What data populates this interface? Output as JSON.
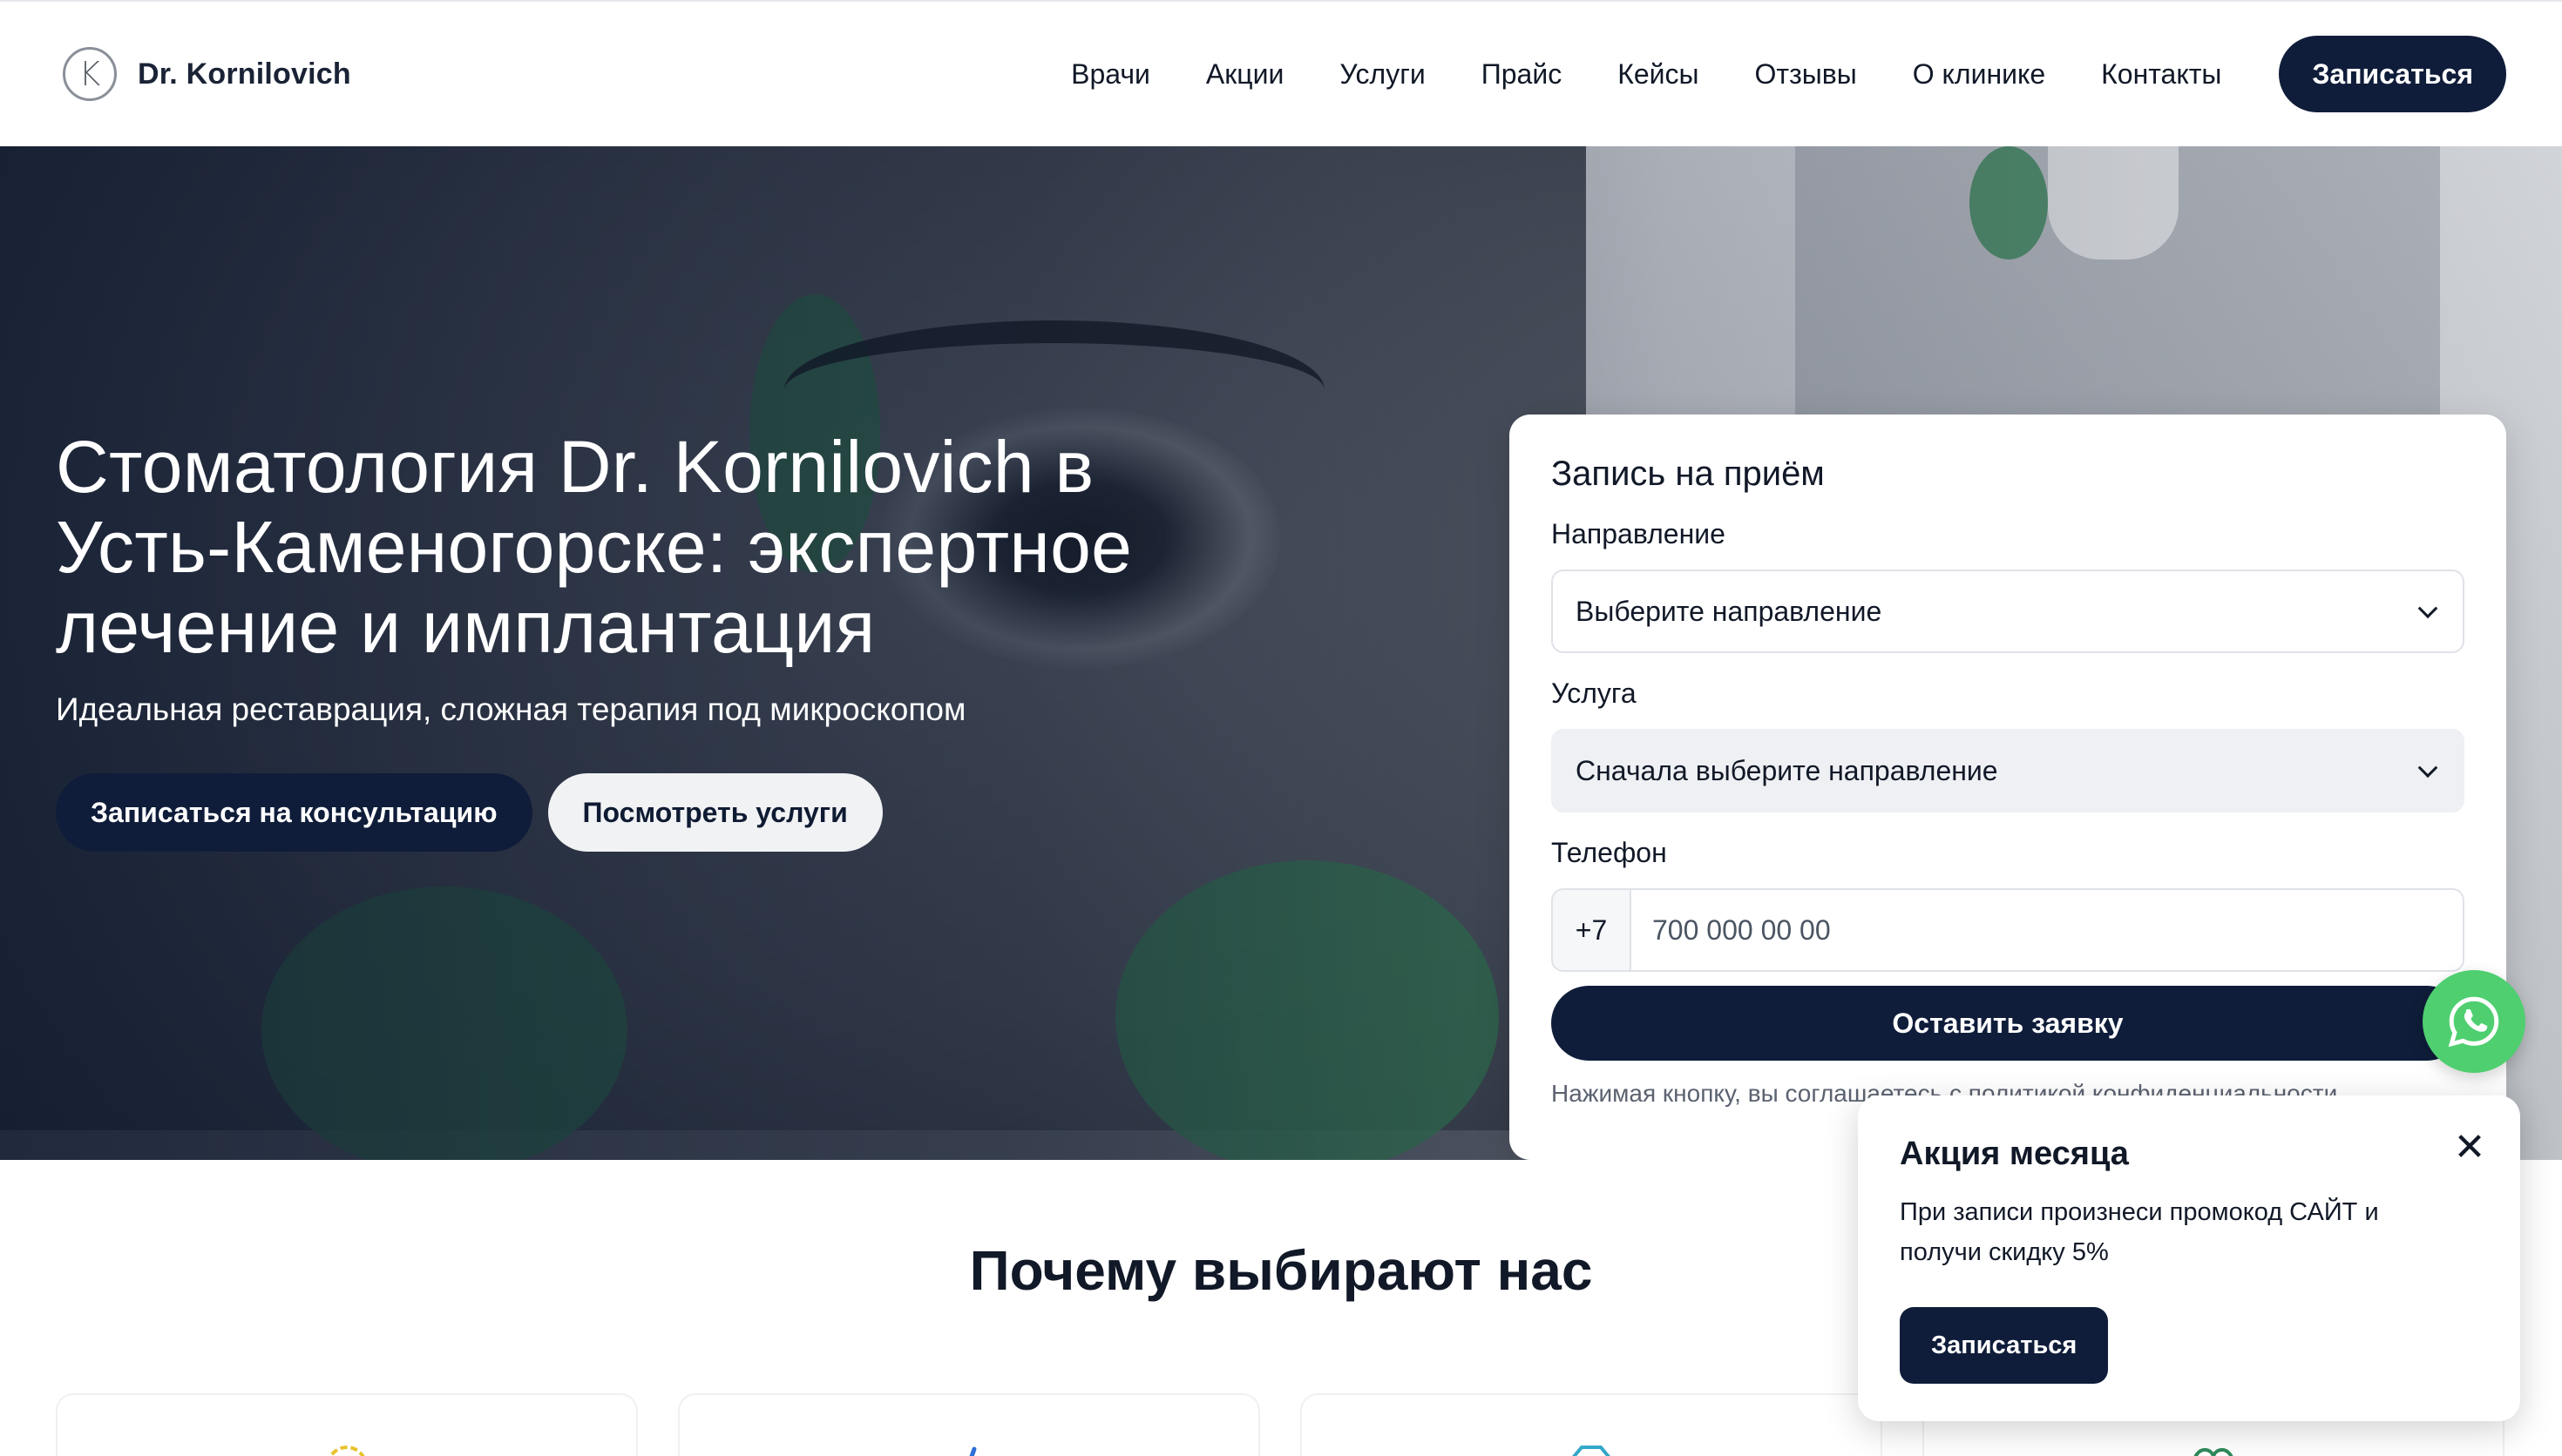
{
  "header": {
    "logo_letter": "K",
    "logo_text": "Dr. Kornilovich",
    "nav": [
      "Врачи",
      "Акции",
      "Услуги",
      "Прайс",
      "Кейсы",
      "Отзывы",
      "О клинике",
      "Контакты"
    ],
    "cta_label": "Записаться"
  },
  "hero": {
    "title": "Стоматология Dr. Kornilovich в Усть-Каменогорске: экспертное лечение и имплантация",
    "subtitle": "Идеальная реставрация, сложная терапия под микроскопом",
    "primary_button": "Записаться на консультацию",
    "secondary_button": "Посмотреть услуги"
  },
  "form": {
    "title": "Запись на приём",
    "direction_label": "Направление",
    "direction_value": "Выберите направление",
    "service_label": "Услуга",
    "service_value": "Сначала выберите направление",
    "phone_label": "Телефон",
    "phone_prefix": "+7",
    "phone_placeholder": "700 000 00 00",
    "submit_label": "Оставить заявку",
    "consent": "Нажимая кнопку, вы соглашаетесь с политикой конфиденциальности."
  },
  "why": {
    "title": "Почему выбирают нас"
  },
  "promo": {
    "title": "Акция месяца",
    "text": "При записи произнеси промокод САЙТ и получи скидку 5%",
    "button": "Записаться",
    "close_symbol": "✕"
  },
  "colors": {
    "primary": "#0f1d3a",
    "whatsapp": "#4fcf70"
  },
  "icons": [
    "logo-icon",
    "chevron-down-icon",
    "whatsapp-icon",
    "close-icon",
    "award-icon",
    "tooth-tool-icon",
    "diamond-icon",
    "heart-icon"
  ]
}
